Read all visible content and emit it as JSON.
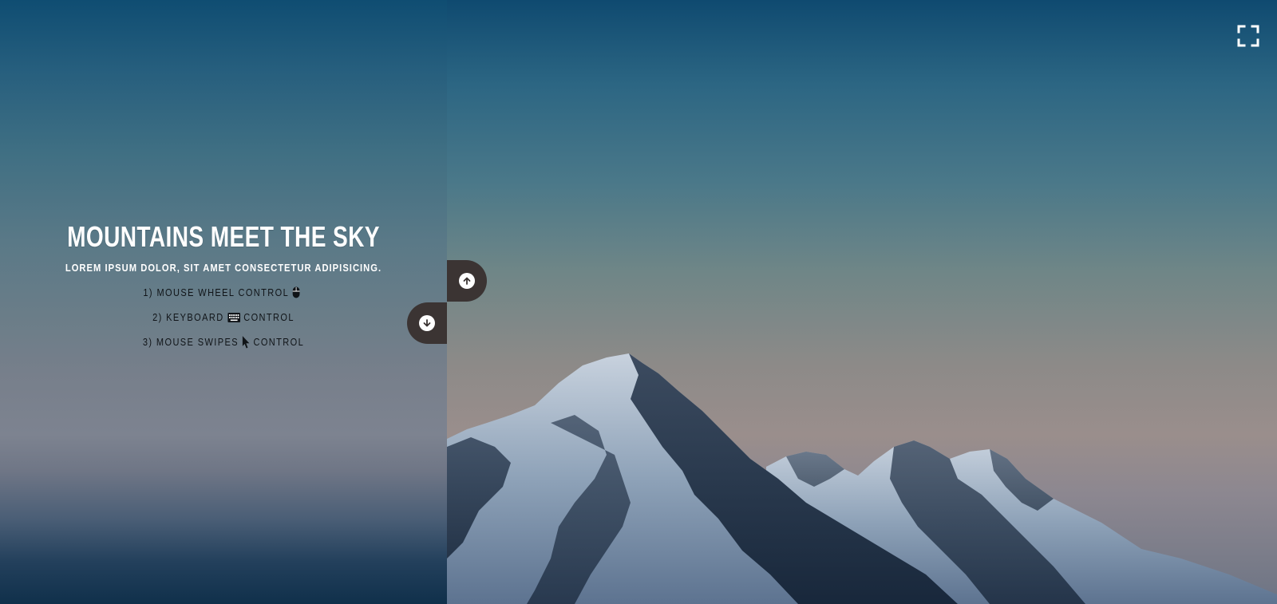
{
  "hero": {
    "title": "Mountains meet the sky",
    "subtitle": "Lorem ipsum dolor, sit amet consectetur adipisicing.",
    "controls": [
      {
        "prefix": "1) Mouse wheel control",
        "suffix": "",
        "icon": "mouse-icon"
      },
      {
        "prefix": "2) Keyboard",
        "suffix": "control",
        "icon": "keyboard-icon"
      },
      {
        "prefix": "3) Mouse swipes",
        "suffix": "control",
        "icon": "cursor-icon"
      }
    ]
  },
  "navigation": {
    "up_icon": "arrow-up-icon",
    "down_icon": "arrow-down-icon",
    "fullscreen_icon": "fullscreen-icon"
  },
  "colors": {
    "nav_button": "#3b3433",
    "title_text": "#ffffff",
    "list_text": "#101418"
  }
}
